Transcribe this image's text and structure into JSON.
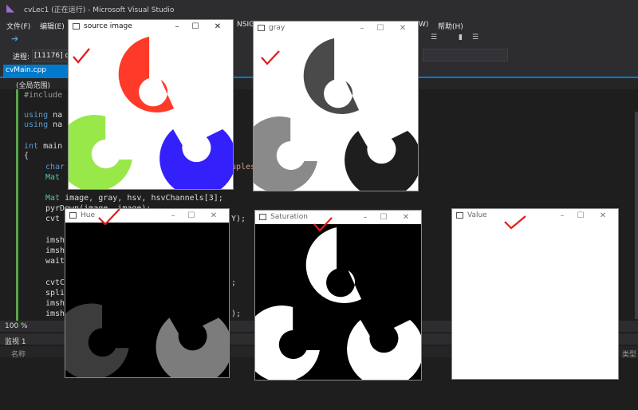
{
  "app": {
    "title": "cvLec1 (正在运行) - Microsoft Visual Studio"
  },
  "menu": {
    "file": "文件(F)",
    "edit": "编辑(E)",
    "nsight": "NSIGHT",
    "window": "W)",
    "help": "帮助(H)"
  },
  "process": {
    "label": "进程:",
    "value": "[11176] cv"
  },
  "editor": {
    "tab_label": "cvMain.cpp",
    "scope": "(全局范围)",
    "zoom": "100 %",
    "lines": {
      "l1": "#include",
      "l2_kw": "using",
      "l2_rest": " na",
      "l3_kw": "using",
      "l3_rest": " na",
      "l4_kw": "int",
      "l4_rest": " main",
      "l5": "{",
      "l6_kw": "char",
      "l6_tail": "uples",
      "l7_ty": "Mat",
      "l8_ty": "Mat",
      "l8_rest": " image, gray, hsv, hsvChannels[3];",
      "l9": "pyrDown(image, image);",
      "l10": "cvt",
      "l10_tail": "Y);",
      "l11": "imsh",
      "l12": "imsh",
      "l13": "wait",
      "l14": "cvtC",
      "l14_tail": ";",
      "l15": "spli",
      "l16": "imsh",
      "l17": "imsh",
      "l17_tail": ");"
    }
  },
  "watch": {
    "title": "监视 1",
    "col_name": "名称",
    "col_type": "类型"
  },
  "windows": {
    "source": {
      "title": "source image"
    },
    "gray": {
      "title": "gray"
    },
    "hue": {
      "title": "Hue"
    },
    "saturation": {
      "title": "Saturation"
    },
    "value": {
      "title": "Value"
    }
  },
  "controls": {
    "minimize": "–",
    "maximize": "☐",
    "close": "✕"
  },
  "colors": {
    "red": "#ff3a28",
    "green": "#98e84a",
    "blue": "#3420fa",
    "gray_top": "#4a4a4a",
    "gray_left": "#8a8a8a",
    "gray_right": "#1e1e1e",
    "hue_left": "#3c3c3c",
    "hue_right": "#7c7c7c",
    "check": "#e11b1b"
  }
}
